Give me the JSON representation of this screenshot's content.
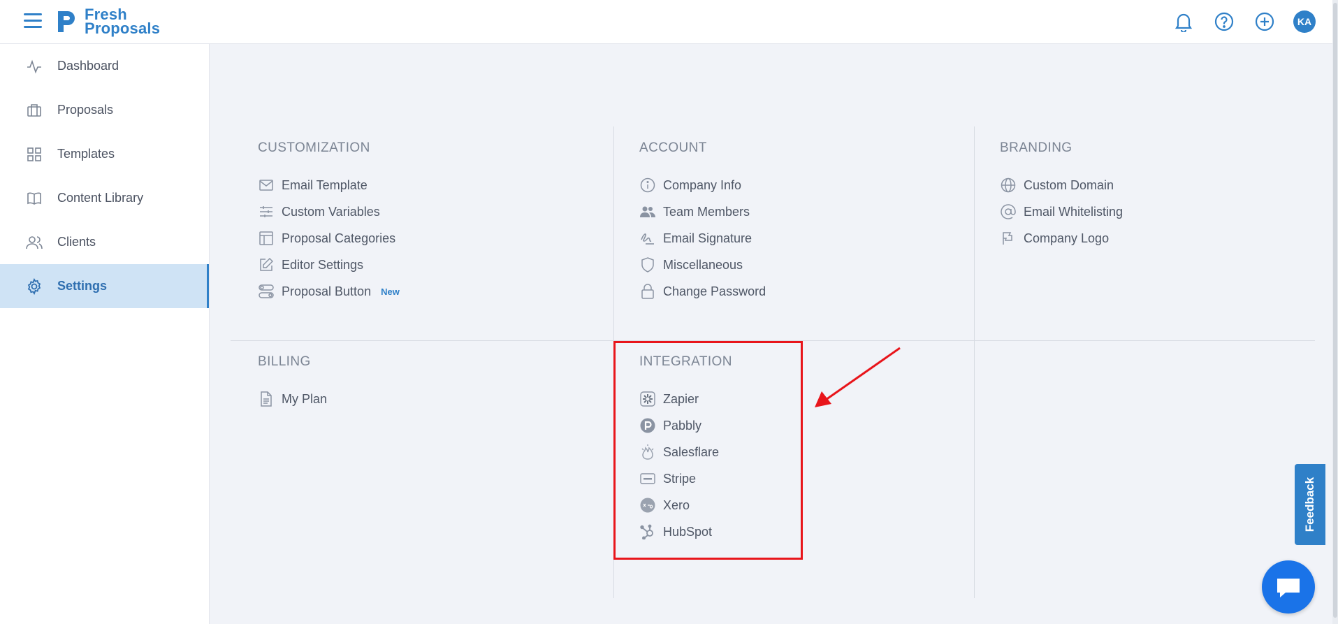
{
  "brand": {
    "line1": "Fresh",
    "line2": "Proposals",
    "color": "#2f80c8"
  },
  "header": {
    "avatar_initials": "KA"
  },
  "sidebar": {
    "items": [
      {
        "label": "Dashboard",
        "icon": "activity-icon"
      },
      {
        "label": "Proposals",
        "icon": "briefcase-icon"
      },
      {
        "label": "Templates",
        "icon": "grid-icon"
      },
      {
        "label": "Content Library",
        "icon": "book-icon"
      },
      {
        "label": "Clients",
        "icon": "users-icon"
      },
      {
        "label": "Settings",
        "icon": "gear-icon",
        "active": true
      }
    ]
  },
  "sections": {
    "customization": {
      "title": "CUSTOMIZATION",
      "links": [
        "Email Template",
        "Custom Variables",
        "Proposal Categories",
        "Editor Settings",
        "Proposal Button"
      ],
      "new_badge": "New"
    },
    "account": {
      "title": "ACCOUNT",
      "links": [
        "Company Info",
        "Team Members",
        "Email Signature",
        "Miscellaneous",
        "Change Password"
      ]
    },
    "branding": {
      "title": "BRANDING",
      "links": [
        "Custom Domain",
        "Email Whitelisting",
        "Company Logo"
      ]
    },
    "billing": {
      "title": "BILLING",
      "links": [
        "My Plan"
      ]
    },
    "integration": {
      "title": "INTEGRATION",
      "links": [
        "Zapier",
        "Pabbly",
        "Salesflare",
        "Stripe",
        "Xero",
        "HubSpot"
      ]
    }
  },
  "feedback": {
    "label": "Feedback"
  },
  "colors": {
    "accent": "#2f80c8",
    "highlight": "#e8151b",
    "active_bg": "#cfe3f5"
  }
}
